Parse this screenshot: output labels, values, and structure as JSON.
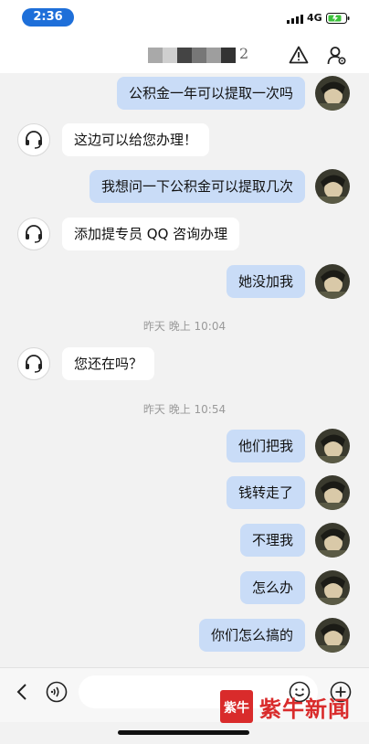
{
  "status_bar": {
    "time": "2:36",
    "network": "4G",
    "icons": [
      "signal-icon",
      "battery-icon"
    ]
  },
  "header": {
    "title_visible_tail": "2",
    "icons": [
      "warning-icon",
      "user-settings-icon"
    ]
  },
  "messages": [
    {
      "side": "out",
      "text": "公积金一年可以提取一次吗"
    },
    {
      "side": "in",
      "text": "这边可以给您办理！"
    },
    {
      "side": "out",
      "text": "我想问一下公积金可以提取几次"
    },
    {
      "side": "in",
      "text": "添加提专员 QQ 咨询办理"
    },
    {
      "side": "out",
      "text": "她没加我"
    },
    {
      "side": "in",
      "text": "您还在吗？"
    },
    {
      "side": "out",
      "text": "他们把我"
    },
    {
      "side": "out",
      "text": "钱转走了"
    },
    {
      "side": "out",
      "text": "不理我"
    },
    {
      "side": "out",
      "text": "怎么办"
    },
    {
      "side": "out",
      "text": "你们怎么搞的"
    }
  ],
  "timestamps": [
    "昨天 晚上 10:04",
    "昨天 晚上 10:54"
  ],
  "input_bar": {
    "placeholder": "",
    "icons": [
      "back-icon",
      "voice-icon",
      "emoji-icon",
      "add-icon"
    ]
  },
  "watermark": {
    "text": "紫牛新闻",
    "logo_text": "紫牛"
  },
  "colors": {
    "outgoing_bubble": "#c9dcf7",
    "incoming_bubble": "#ffffff",
    "background": "#f2f2f2",
    "time_pill": "#1e6fd9",
    "watermark": "#d92b2b"
  }
}
